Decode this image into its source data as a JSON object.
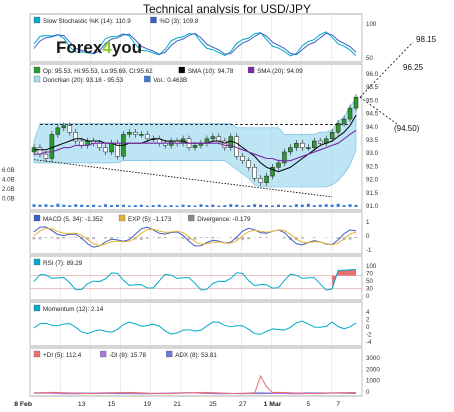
{
  "title": "Technical analysis for USD/JPY",
  "logo": {
    "text_a": "Forex",
    "text_b": "4",
    "text_c": "you"
  },
  "colors": {
    "bg": "#ffffff",
    "grid": "#d8d8d8",
    "border": "#9a9a9a",
    "cyan": "#00aacc",
    "blue": "#3a60c8",
    "black": "#000000",
    "green": "#2a9a2a",
    "red": "#cc2222",
    "purple": "#7a2aa8",
    "donchian": "#a8dcf0",
    "volume": "#3a7ad8",
    "rsi_over": "#e87070",
    "adx": "#6a7ad8",
    "dmi_pos": "#e87070",
    "dmi_neg": "#a878d8"
  },
  "panels": [
    {
      "id": "stoch",
      "legend": [
        {
          "label": "Slow Stochastic %K (14): 110.9",
          "color": "#00aacc"
        },
        {
          "label": "%D (3): 109.8",
          "color": "#3a60c8"
        }
      ],
      "ticks": [
        "100",
        "50"
      ]
    },
    {
      "id": "price",
      "legend": [
        {
          "label": "Op: 95.53, Hi:95.53, Lo:95.69, Cl:95.62",
          "color": "#2a9a2a"
        },
        {
          "label": "SMA (10): 94.78",
          "color": "#000000"
        },
        {
          "label": "SMA (20): 94.09",
          "color": "#7a2aa8"
        }
      ],
      "legend2": [
        {
          "label": "Donchian (20): 93.18 - 95.53",
          "color": "#a8dcf0"
        },
        {
          "label": "Vol.: 0.463B",
          "color": "#3a7ad8"
        }
      ],
      "ticks": [
        "96.0",
        "95.5",
        "95.0",
        "94.5",
        "94.0",
        "93.5",
        "93.0",
        "92.5",
        "92.0",
        "91.5",
        "91.0"
      ],
      "vol_ticks": [
        "6.0B",
        "4.0B",
        "2.0B",
        "0.0B"
      ]
    },
    {
      "id": "macd",
      "legend": [
        {
          "label": "MACD (5, 34): -1.352",
          "color": "#3a60c8"
        },
        {
          "label": "EXP (5): -1.173",
          "color": "#e8b030"
        },
        {
          "label": "Divergence: -0.179",
          "color": "#888888"
        }
      ],
      "ticks": [
        "1",
        "0",
        "-1"
      ]
    },
    {
      "id": "rsi",
      "legend": [
        {
          "label": "RSI (7): 89.29",
          "color": "#00aacc"
        }
      ],
      "ticks": [
        "100",
        "70",
        "50",
        "30",
        "0"
      ]
    },
    {
      "id": "mom",
      "legend": [
        {
          "label": "Momentum (12): 2.14",
          "color": "#00aacc"
        }
      ],
      "ticks": [
        "4",
        "2",
        "0",
        "-2",
        "-4"
      ]
    },
    {
      "id": "adx",
      "legend": [
        {
          "label": "+DI (5): 112.4",
          "color": "#e87070"
        },
        {
          "label": "-DI (8): 15.78",
          "color": "#a878d8"
        },
        {
          "label": "ADX (8): 53.81",
          "color": "#6a7ad8"
        }
      ],
      "ticks": [
        "3000",
        "2000",
        "1000",
        "0"
      ]
    }
  ],
  "forecast": {
    "labels": [
      "98.15",
      "96.25",
      "(94.50)"
    ]
  },
  "chart_data": {
    "type": "candlestick",
    "x_labels": [
      "8 Feb",
      "13",
      "15",
      "19",
      "21",
      "25",
      "27",
      "1 Mar",
      "5",
      "7"
    ],
    "ylim": [
      91.0,
      96.2
    ],
    "close": [
      93.3,
      93.0,
      92.8,
      93.9,
      94.2,
      94.3,
      94.0,
      93.6,
      93.4,
      93.6,
      93.5,
      93.3,
      93.1,
      93.5,
      92.9,
      93.9,
      94.0,
      93.9,
      93.9,
      93.7,
      93.7,
      93.5,
      93.4,
      93.6,
      93.5,
      93.7,
      93.3,
      93.4,
      93.5,
      93.7,
      93.8,
      93.6,
      93.3,
      93.8,
      92.9,
      92.7,
      92.4,
      91.9,
      91.7,
      92.0,
      92.4,
      92.6,
      93.1,
      93.3,
      93.5,
      93.3,
      93.3,
      93.6,
      93.5,
      93.7,
      94.0,
      94.4,
      94.6,
      95.1,
      95.6
    ],
    "sma10": [
      93.2,
      93.2,
      93.2,
      93.3,
      93.4,
      93.5,
      93.6,
      93.7,
      93.7,
      93.6,
      93.6,
      93.6,
      93.5,
      93.5,
      93.4,
      93.4,
      93.5,
      93.5,
      93.5,
      93.6,
      93.7,
      93.7,
      93.6,
      93.6,
      93.6,
      93.6,
      93.5,
      93.5,
      93.5,
      93.5,
      93.6,
      93.6,
      93.5,
      93.6,
      93.5,
      93.3,
      93.1,
      92.9,
      92.6,
      92.4,
      92.3,
      92.2,
      92.3,
      92.4,
      92.6,
      92.8,
      93.0,
      93.2,
      93.4,
      93.5,
      93.6,
      93.8,
      94.0,
      94.3,
      94.78
    ],
    "sma20": [
      93.0,
      93.0,
      93.1,
      93.1,
      93.2,
      93.3,
      93.3,
      93.4,
      93.4,
      93.4,
      93.5,
      93.5,
      93.5,
      93.5,
      93.5,
      93.5,
      93.5,
      93.5,
      93.5,
      93.5,
      93.5,
      93.5,
      93.5,
      93.5,
      93.5,
      93.5,
      93.5,
      93.5,
      93.5,
      93.5,
      93.5,
      93.5,
      93.4,
      93.4,
      93.3,
      93.2,
      93.1,
      93.0,
      92.9,
      92.8,
      92.8,
      92.7,
      92.7,
      92.7,
      92.8,
      92.9,
      93.0,
      93.1,
      93.2,
      93.3,
      93.4,
      93.5,
      93.7,
      93.9,
      94.09
    ],
    "donchian_upper": [
      93.6,
      94.4,
      94.4,
      94.4,
      94.4,
      94.4,
      94.4,
      94.4,
      94.4,
      94.4,
      94.4,
      94.4,
      94.4,
      94.4,
      94.4,
      94.4,
      94.4,
      94.4,
      94.4,
      94.4,
      94.4,
      94.4,
      94.4,
      94.4,
      94.4,
      94.4,
      94.4,
      94.4,
      94.4,
      94.4,
      94.4,
      94.4,
      94.4,
      94.4,
      94.2,
      94.2,
      94.2,
      94.2,
      94.2,
      94.2,
      94.2,
      94.2,
      93.9,
      93.9,
      93.9,
      93.9,
      93.9,
      93.9,
      94.0,
      94.0,
      94.1,
      94.5,
      94.7,
      95.2,
      95.53
    ],
    "donchian_lower": [
      92.6,
      92.6,
      92.6,
      92.6,
      92.6,
      92.6,
      92.6,
      92.6,
      92.6,
      92.6,
      92.6,
      92.6,
      92.6,
      92.6,
      92.6,
      92.7,
      92.7,
      92.7,
      92.7,
      92.7,
      92.7,
      92.7,
      92.7,
      92.7,
      92.7,
      92.7,
      92.7,
      92.7,
      92.7,
      92.7,
      92.7,
      92.7,
      92.7,
      92.5,
      92.3,
      92.1,
      91.9,
      91.6,
      91.5,
      91.5,
      91.5,
      91.5,
      91.5,
      91.5,
      91.5,
      91.5,
      91.5,
      91.5,
      91.5,
      91.5,
      91.6,
      91.8,
      92.1,
      92.5,
      93.18
    ],
    "volume_b": [
      0.6,
      0.5,
      0.6,
      0.4,
      0.7,
      0.5,
      0.4,
      0.6,
      0.5,
      0.4,
      0.5,
      0.3,
      0.6,
      0.4,
      0.5,
      0.5,
      0.3,
      0.4,
      0.5,
      0.3,
      0.4,
      0.5,
      0.3,
      0.4,
      0.3,
      0.5,
      0.4,
      0.3,
      0.6,
      0.4,
      0.5,
      0.3,
      0.4,
      0.6,
      0.5,
      0.3,
      0.4,
      0.6,
      0.5,
      0.4,
      0.3,
      0.5,
      0.4,
      0.3,
      0.6,
      0.5,
      0.7,
      0.4,
      0.5,
      0.6,
      0.5,
      0.7,
      0.4,
      0.6,
      0.463
    ]
  }
}
